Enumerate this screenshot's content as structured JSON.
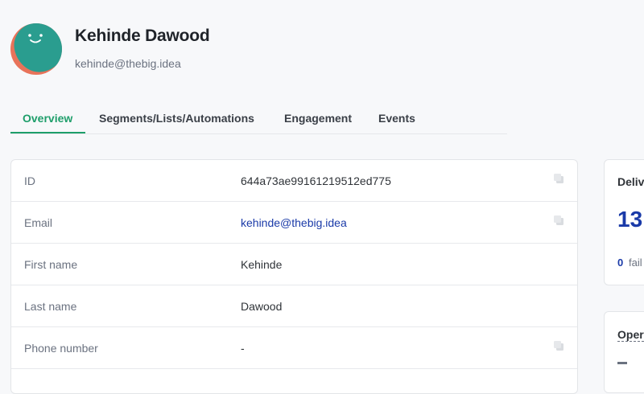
{
  "profile": {
    "name": "Kehinde Dawood",
    "email": "kehinde@thebig.idea"
  },
  "tabs": [
    {
      "label": "Overview",
      "active": true
    },
    {
      "label": "Segments/Lists/Automations",
      "active": false
    },
    {
      "label": "Engagement",
      "active": false
    },
    {
      "label": "Events",
      "active": false
    }
  ],
  "details": [
    {
      "label": "ID",
      "value": "644a73ae99161219512ed775",
      "copyable": true
    },
    {
      "label": "Email",
      "value": "kehinde@thebig.idea",
      "copyable": true,
      "link": true
    },
    {
      "label": "First name",
      "value": "Kehinde",
      "copyable": false
    },
    {
      "label": "Last name",
      "value": "Dawood",
      "copyable": false
    },
    {
      "label": "Phone number",
      "value": "-",
      "copyable": true
    }
  ],
  "side_cards": {
    "delivered": {
      "title": "Deliv",
      "value": "13",
      "failed_count": "0",
      "failed_label": "fail"
    },
    "opens": {
      "title": "Oper",
      "value": "-"
    }
  },
  "colors": {
    "accent": "#1e9e6a",
    "link": "#1a3aa8",
    "avatar_bg": "#e8735a",
    "avatar_face": "#2a9d8f"
  },
  "icons": {
    "copy": "copy-icon",
    "avatar": "smiley-avatar"
  }
}
